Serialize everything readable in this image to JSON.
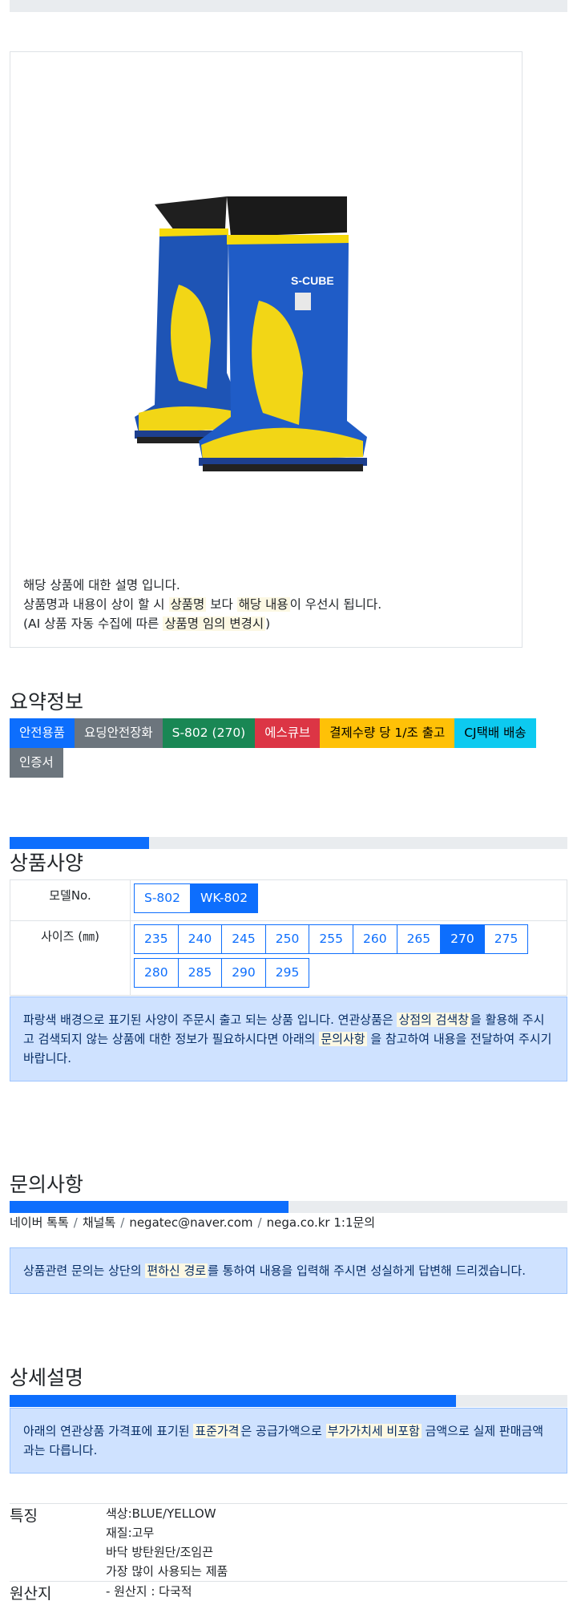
{
  "product": {
    "image_alt": "S-CUBE 안전장화",
    "logo_text": "S-CUBE",
    "desc": {
      "line1": "해당 상품에 대한 설명 입니다.",
      "line2_pre": "상품명과 내용이 상이 할 시 ",
      "line2_mark1": "상품명",
      "line2_mid": " 보다 ",
      "line2_mark2": "해당 내용",
      "line2_post": "이 우선시 됩니다.",
      "line3_pre": "(AI 상품 자동 수집에 따른 ",
      "line3_mark": "상품명 임의 변경시",
      "line3_post": ")"
    }
  },
  "summary": {
    "title": "요약정보",
    "badges": [
      "안전용품",
      "요딩안전장화",
      "S-802 (270)",
      "에스큐브",
      "결제수량 당 1/조 출고",
      "CJ택배 배송",
      "인증서"
    ]
  },
  "specs": {
    "title": "상품사양",
    "progress": 0.25,
    "model_label": "모델No.",
    "models": [
      "S-802",
      "WK-802"
    ],
    "model_selected": "WK-802",
    "size_label": "사이즈 (㎜)",
    "sizes": [
      "235",
      "240",
      "245",
      "250",
      "255",
      "260",
      "265",
      "270",
      "275",
      "280",
      "285",
      "290",
      "295"
    ],
    "size_selected": "270",
    "notice": {
      "pre": "파랑색 배경으로 표기된 사양이 주문시 출고 되는 상품 입니다. 연관상품은 ",
      "mark1": "상점의 검색창",
      "mid": "을 활용해 주시고 검색되지 않는 상품에 대한 정보가 필요하시다면 아래의 ",
      "mark2": "문의사항",
      "post": " 을 참고하여 내용을 전달하여 주시기 바랍니다."
    }
  },
  "inquiry": {
    "title": "문의사항",
    "progress": 0.5,
    "channels": [
      "네이버 톡톡",
      "채널톡",
      "negatec@naver.com",
      "nega.co.kr 1:1문의"
    ],
    "notice": {
      "pre": "상품관련 문의는 상단의 ",
      "mark": "편하신 경로",
      "post": "를 통하여 내용을 입력해 주시면 성실하게 답변해 드리겠습니다."
    }
  },
  "detail": {
    "title": "상세설명",
    "progress": 0.8,
    "notice": {
      "pre": "아래의 연관상품 가격표에 표기된 ",
      "mark1": "표준가격",
      "mid": "은 공급가액으로 ",
      "mark2": "부가가치세 비포함",
      "post": " 금액으로 실제 판매금액과는 다릅니다."
    },
    "features_label": "특징",
    "features": [
      "색상:BLUE/YELLOW",
      "재질:고무",
      "바닥 방탄원단/조임끈",
      "가장 많이 사용되는 제품"
    ],
    "origin_label": "원산지",
    "origin": "- 원산지 : 다국적"
  },
  "colors": {
    "primary": "#0d6efd",
    "alert_bg": "#cfe2ff",
    "mark_bg": "#fcf8e3"
  }
}
